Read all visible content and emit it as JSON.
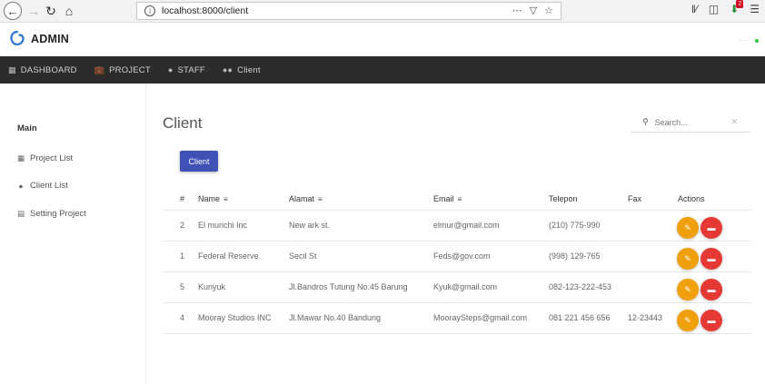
{
  "browser": {
    "url": "localhost:8000/client",
    "notification_count": "2"
  },
  "header": {
    "brand": "ADMIN",
    "dots": "..."
  },
  "nav": {
    "items": [
      {
        "label": "DASHBOARD",
        "icon": "dashboard-icon"
      },
      {
        "label": "PROJECT",
        "icon": "briefcase-icon"
      },
      {
        "label": "STAFF",
        "icon": "person-icon"
      },
      {
        "label": "Client",
        "icon": "people-icon"
      }
    ]
  },
  "sidebar": {
    "heading": "Main",
    "items": [
      {
        "label": "Project List",
        "icon": "grid-icon"
      },
      {
        "label": "Client List",
        "icon": "people-icon"
      },
      {
        "label": "Setting Project",
        "icon": "clipboard-icon"
      }
    ]
  },
  "main": {
    "title": "Client",
    "search_placeholder": "Search...",
    "client_button": "Client"
  },
  "table": {
    "headers": [
      "#",
      "Name",
      "Alamat",
      "Email",
      "Telepon",
      "Fax",
      "Actions"
    ],
    "rows": [
      {
        "id": "2",
        "name": "El murichi Inc",
        "alamat": "New ark st.",
        "email": "elmur@gmail.com",
        "telepon": "(210) 775-990",
        "fax": ""
      },
      {
        "id": "1",
        "name": "Federal Reserve",
        "alamat": "Secil St",
        "email": "Feds@gov.com",
        "telepon": "(998) 129-765",
        "fax": ""
      },
      {
        "id": "5",
        "name": "Kunyuk",
        "alamat": "Jl.Bandros Tutung No.45 Barung",
        "email": "Kyuk@gmail.com",
        "telepon": "082-123-222-453",
        "fax": ""
      },
      {
        "id": "4",
        "name": "Mooray Studios INC",
        "alamat": "Jl.Mawar No.40 Bandung",
        "email": "MooraySteps@gmail.com",
        "telepon": "081 221 456 656",
        "fax": "12-23443"
      }
    ]
  },
  "colors": {
    "nav_bg": "#2c2c2c",
    "primary": "#3f51b5",
    "edit": "#f0a00c",
    "delete": "#e53935",
    "logo": "#3a7bd5"
  }
}
